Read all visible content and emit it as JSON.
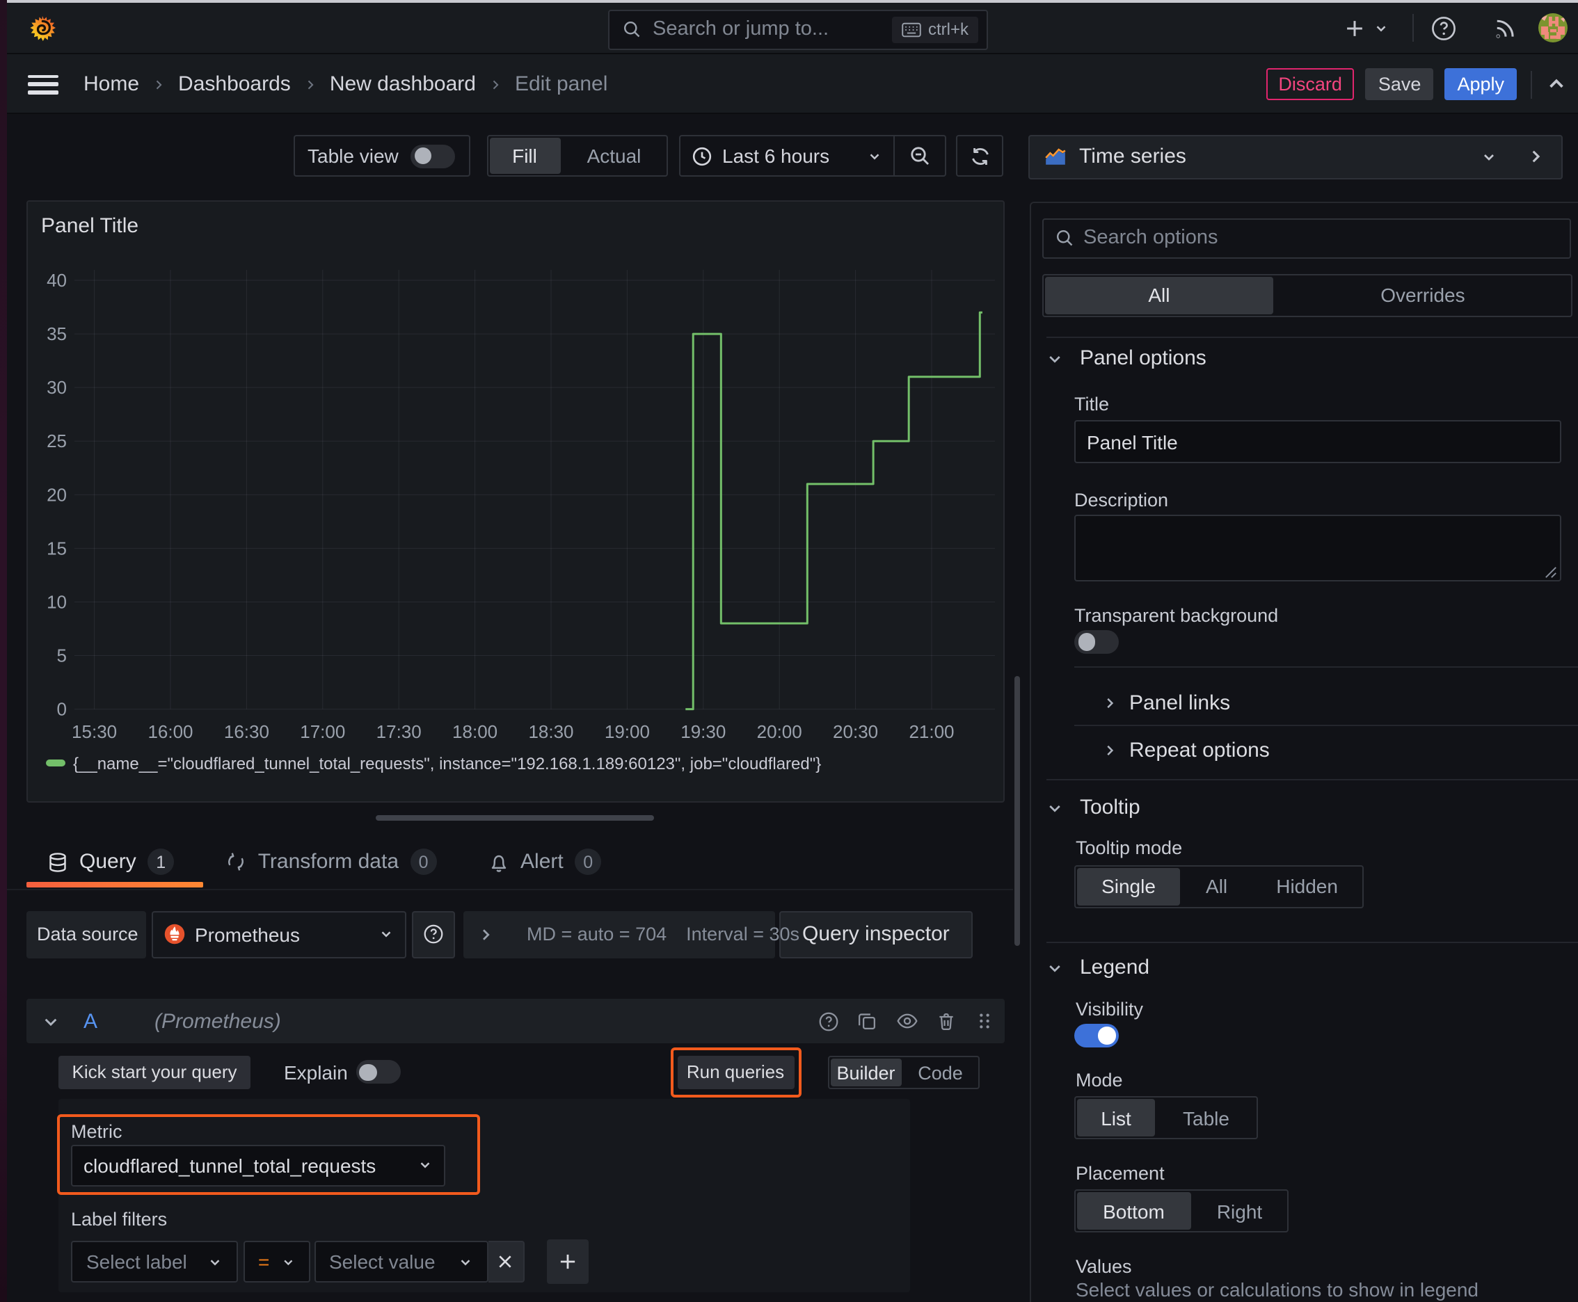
{
  "topnav": {
    "search_placeholder": "Search or jump to...",
    "shortcut": "ctrl+k"
  },
  "breadcrumbs": {
    "items": [
      "Home",
      "Dashboards",
      "New dashboard",
      "Edit panel"
    ]
  },
  "actions": {
    "discard": "Discard",
    "save": "Save",
    "apply": "Apply"
  },
  "toolbar": {
    "table_view_label": "Table view",
    "fill": "Fill",
    "actual": "Actual",
    "time_range": "Last 6 hours"
  },
  "panel": {
    "title": "Panel Title",
    "legend": "{__name__=\"cloudflared_tunnel_total_requests\", instance=\"192.168.1.189:60123\", job=\"cloudflared\"}"
  },
  "chart_data": {
    "type": "line",
    "title": "Panel Title",
    "xlabel": "",
    "ylabel": "",
    "ylim": [
      0,
      40
    ],
    "y_ticks": [
      0,
      5,
      10,
      15,
      20,
      25,
      30,
      35,
      40
    ],
    "x_ticks": [
      "15:30",
      "16:00",
      "16:30",
      "17:00",
      "17:30",
      "18:00",
      "18:30",
      "19:00",
      "19:30",
      "20:00",
      "20:30",
      "21:00"
    ],
    "grid": true,
    "legend_position": "bottom",
    "series": [
      {
        "name": "{__name__=\"cloudflared_tunnel_total_requests\", instance=\"192.168.1.189:60123\", job=\"cloudflared\"}",
        "color": "#73bf69",
        "mode": "step-after",
        "points": [
          [
            "19:23",
            0
          ],
          [
            "19:26",
            35
          ],
          [
            "19:37",
            8
          ],
          [
            "20:11",
            21
          ],
          [
            "20:37",
            25
          ],
          [
            "20:51",
            31
          ],
          [
            "21:19",
            37
          ],
          [
            "21:20",
            37
          ]
        ]
      }
    ]
  },
  "tabs": {
    "query": {
      "label": "Query",
      "badge": "1"
    },
    "transform": {
      "label": "Transform data",
      "badge": "0"
    },
    "alert": {
      "label": "Alert",
      "badge": "0"
    }
  },
  "datasource": {
    "label": "Data source",
    "name": "Prometheus",
    "stat_md": "MD = auto = 704",
    "stat_interval": "Interval = 30s",
    "inspector": "Query inspector"
  },
  "query_row": {
    "ref_id": "A",
    "hint": "(Prometheus)"
  },
  "query_toolbar": {
    "kick_start": "Kick start your query",
    "explain": "Explain",
    "run_queries": "Run queries",
    "builder": "Builder",
    "code": "Code"
  },
  "builder": {
    "metric_label": "Metric",
    "metric_value": "cloudflared_tunnel_total_requests",
    "label_filters": "Label filters",
    "select_label": "Select label",
    "operator": "=",
    "select_value": "Select value"
  },
  "sidebar": {
    "viz_name": "Time series",
    "search_placeholder": "Search options",
    "filter_tabs": {
      "all": "All",
      "overrides": "Overrides"
    },
    "panel_options": {
      "title": "Panel options",
      "title_label": "Title",
      "title_value": "Panel Title",
      "description_label": "Description",
      "transparent_label": "Transparent background",
      "panel_links": "Panel links",
      "repeat_options": "Repeat options"
    },
    "tooltip": {
      "title": "Tooltip",
      "mode_label": "Tooltip mode",
      "options": [
        "Single",
        "All",
        "Hidden"
      ]
    },
    "legend": {
      "title": "Legend",
      "visibility_label": "Visibility",
      "mode_label": "Mode",
      "mode_options": [
        "List",
        "Table"
      ],
      "placement_label": "Placement",
      "placement_options": [
        "Bottom",
        "Right"
      ],
      "values_label": "Values",
      "values_hint": "Select values or calculations to show in legend"
    }
  },
  "colors": {
    "accent_blue": "#3d71d9",
    "series_green": "#73bf69",
    "annotation_orange": "#f25a1d",
    "destructive_pink": "#e0256d",
    "tab_gradient_start": "#f55f3e",
    "tab_gradient_end": "#ff8833"
  }
}
